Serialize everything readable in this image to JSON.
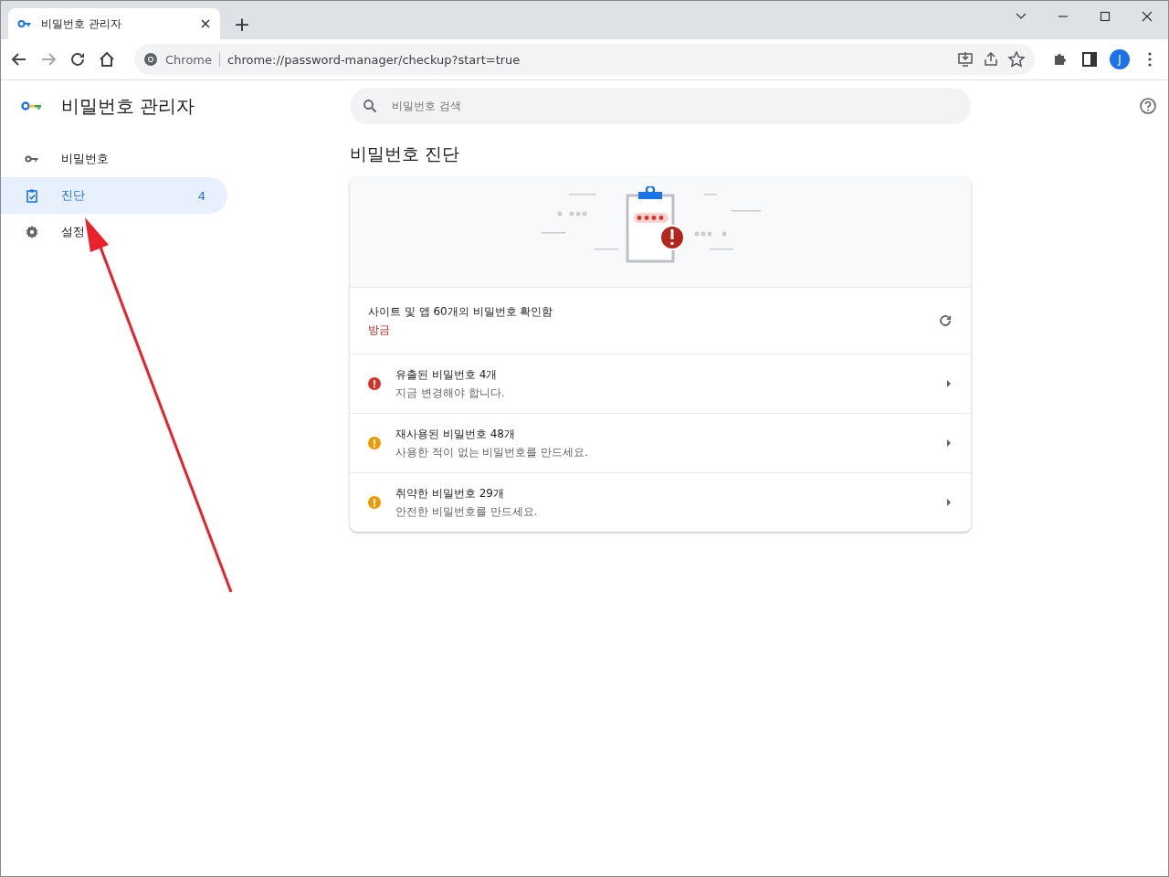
{
  "browser": {
    "tab": {
      "title": "비밀번호 관리자",
      "selected": true
    },
    "new_tab": "+",
    "omnibox": {
      "site_label": "Chrome",
      "url": "chrome://password-manager/checkup?start=true"
    },
    "avatar": "J"
  },
  "app": {
    "title": "비밀번호 관리자",
    "search": {
      "placeholder": "비밀번호 검색"
    }
  },
  "sidebar": {
    "items": [
      {
        "kind": "key",
        "label": "비밀번호",
        "selected": false
      },
      {
        "kind": "checkup",
        "label": "진단",
        "count": "4",
        "selected": true
      },
      {
        "kind": "settings",
        "label": "설정",
        "selected": false
      }
    ]
  },
  "page": {
    "heading": "비밀번호 진단",
    "summary": {
      "title": "사이트 및 앱 60개의 비밀번호 확인함",
      "time": "방금"
    },
    "issues": [
      {
        "title": "유출된 비밀번호 4개",
        "subtitle": "지금 변경해야 합니다.",
        "color": "#d93025"
      },
      {
        "title": "재사용된 비밀번호 48개",
        "subtitle": "사용한 적이 없는 비밀번호를 만드세요.",
        "color": "#f29900"
      },
      {
        "title": "취약한 비밀번호 29개",
        "subtitle": "안전한 비밀번호를 만드세요.",
        "color": "#f29900"
      }
    ]
  }
}
